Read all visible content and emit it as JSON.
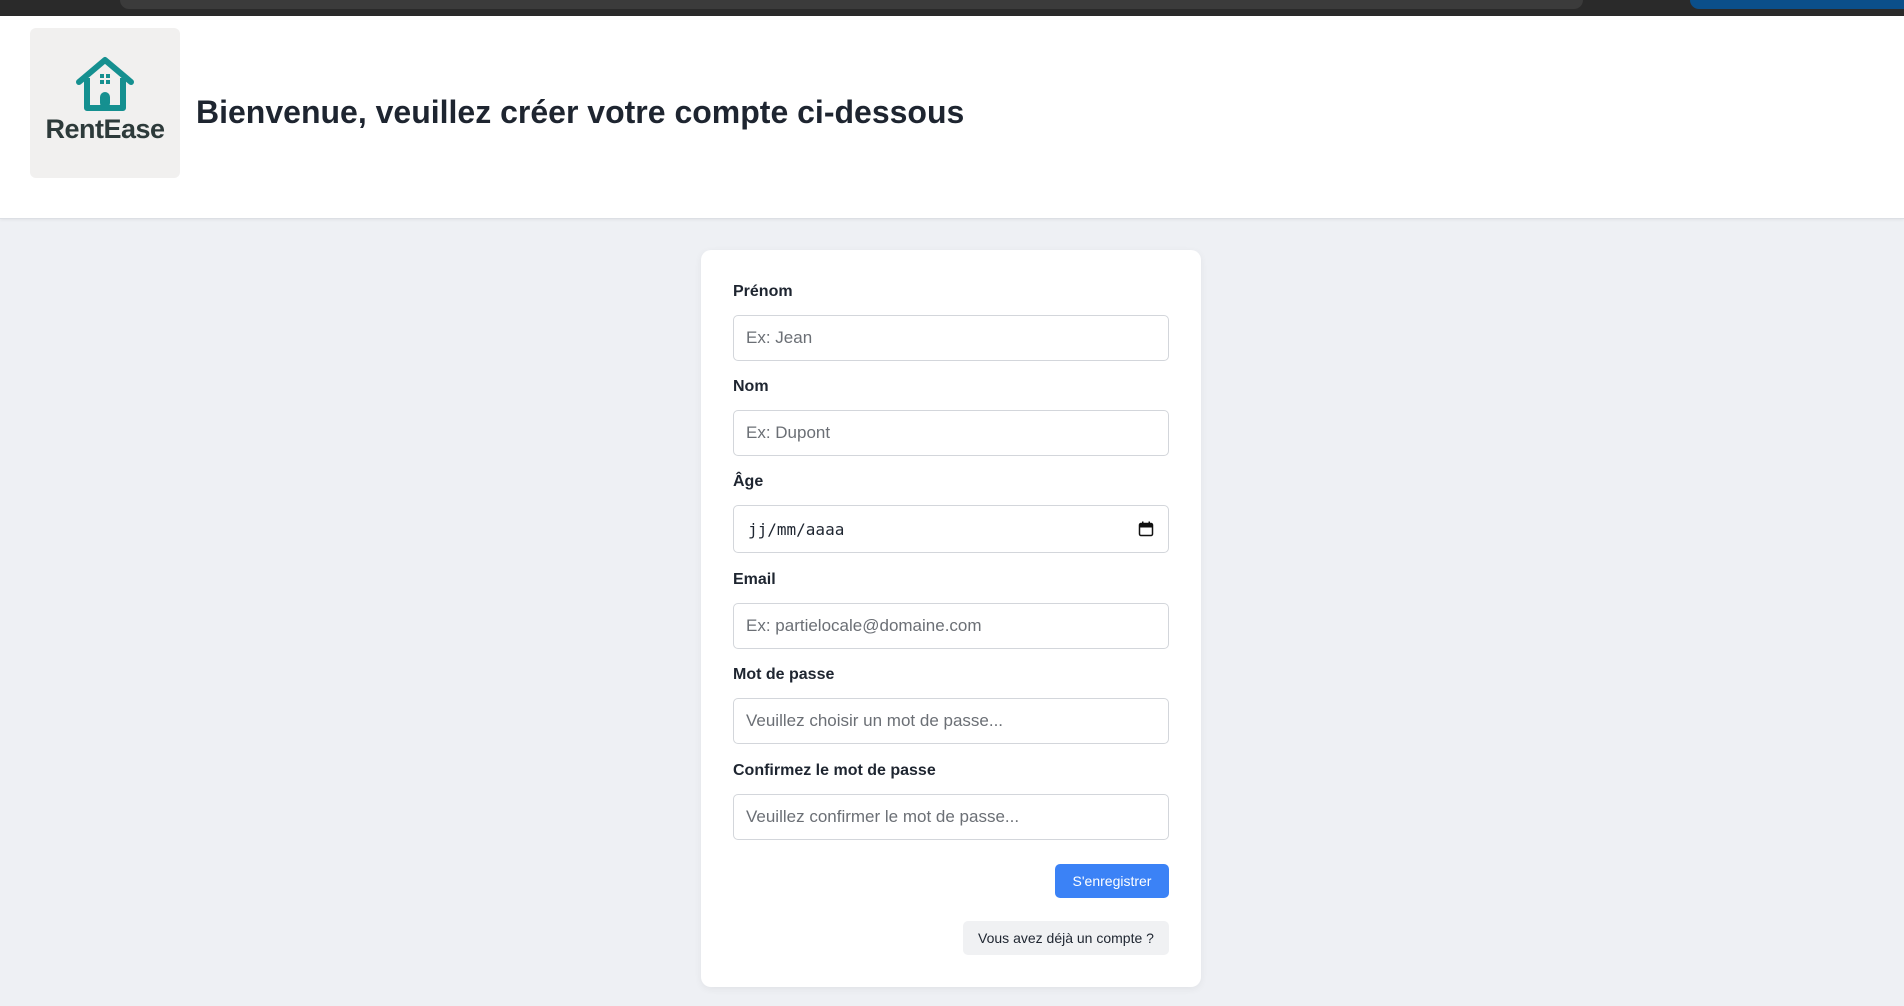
{
  "brand": {
    "name": "RentEase",
    "color": "#159090"
  },
  "header": {
    "title": "Bienvenue, veuillez créer votre compte ci-dessous"
  },
  "form": {
    "firstname": {
      "label": "Prénom",
      "placeholder": "Ex: Jean",
      "value": ""
    },
    "lastname": {
      "label": "Nom",
      "placeholder": "Ex: Dupont",
      "value": ""
    },
    "age": {
      "label": "Âge",
      "placeholder": "jj/mm/aaaa",
      "icon": "calendar-icon"
    },
    "email": {
      "label": "Email",
      "placeholder": "Ex: partielocale@domaine.com",
      "value": ""
    },
    "password": {
      "label": "Mot de passe",
      "placeholder": "Veuillez choisir un mot de passe...",
      "value": ""
    },
    "password_confirm": {
      "label": "Confirmez le mot de passe",
      "placeholder": "Veuillez confirmer le mot de passe...",
      "value": ""
    },
    "submit_label": "S'enregistrer",
    "login_label": "Vous avez déjà un compte ?"
  },
  "colors": {
    "primary_button": "#3b82f6",
    "page_background": "#eef0f4"
  }
}
